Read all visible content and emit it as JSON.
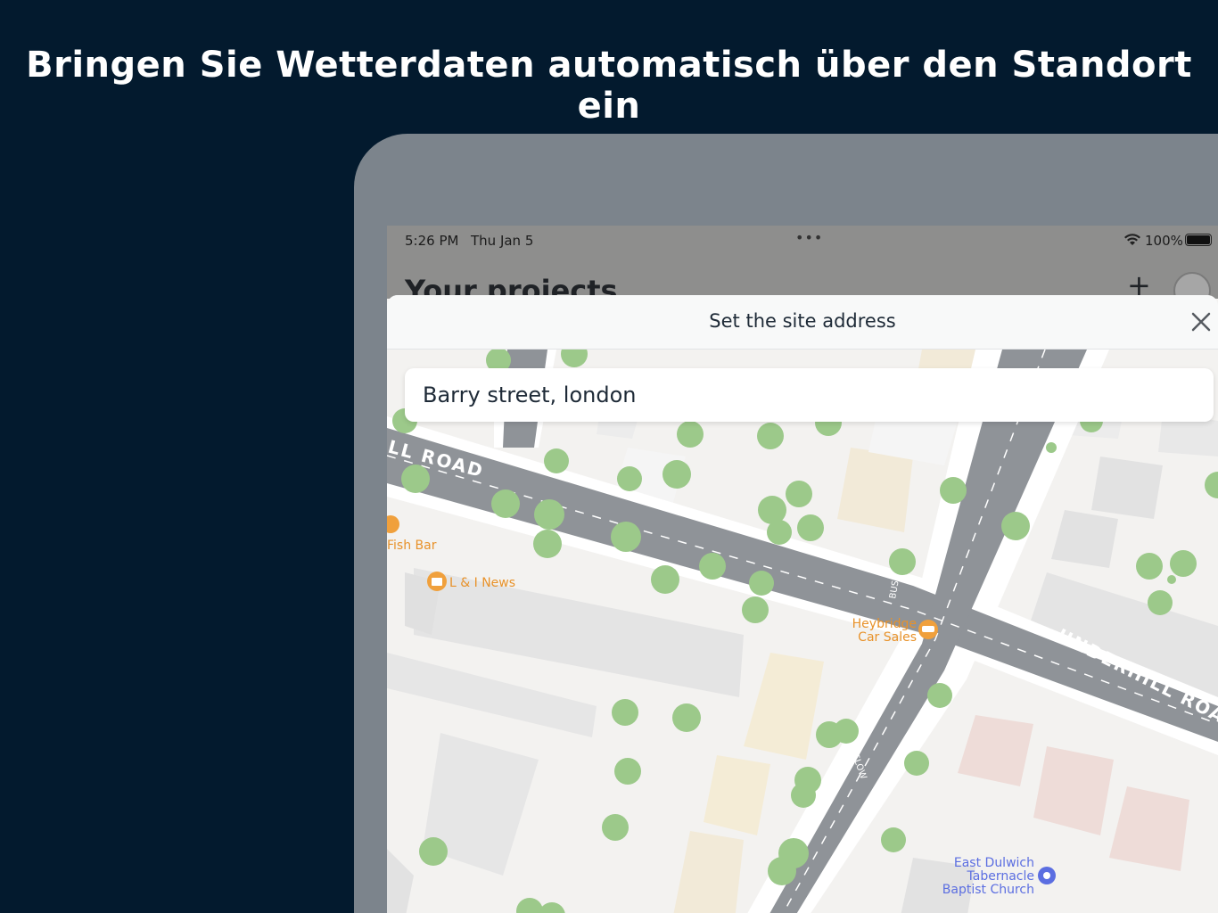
{
  "headline": "Bringen Sie Wetterdaten automatisch über den Standort ein",
  "status_bar": {
    "time": "5:26 PM",
    "date": "Thu Jan 5",
    "battery": "100%"
  },
  "background_screen": {
    "title": "Your projects"
  },
  "sheet": {
    "title": "Set the site address"
  },
  "search": {
    "value": "Barry street, london"
  },
  "map": {
    "road_labels": [
      "LL ROAD",
      "UNDERHILL ROAD",
      "SLOW",
      "BUS"
    ],
    "pois": [
      {
        "name": "Fish Bar"
      },
      {
        "name": "L & I News"
      },
      {
        "name_line1": "Heybridge",
        "name_line2": "Car Sales"
      },
      {
        "name_line1": "East Dulwich",
        "name_line2": "Tabernacle",
        "name_line3": "Baptist Church"
      }
    ],
    "colors": {
      "road": "#8f9398",
      "sidewalk": "#ffffff",
      "ground": "#f3f2f0",
      "building": "#e6e6e6",
      "building_tan": "#f2ead8",
      "building_pink": "#eedcd8",
      "tree": "#9cc98a",
      "poi_orange": "#f0a03c",
      "poi_blue": "#5b6ee1"
    }
  }
}
